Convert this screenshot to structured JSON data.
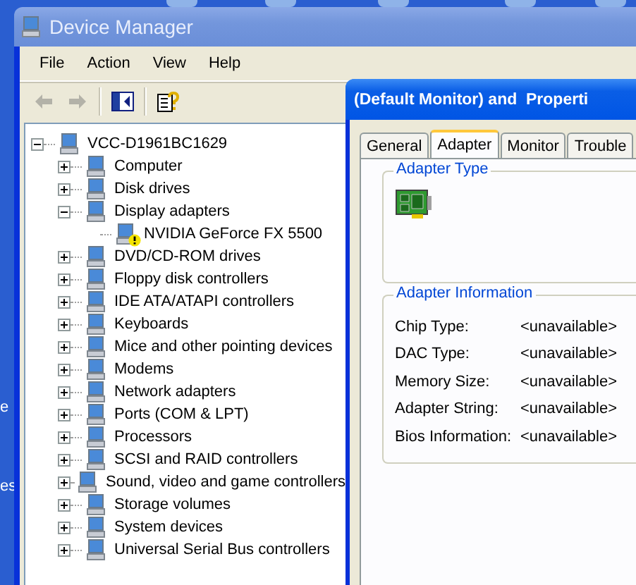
{
  "desktop": {
    "labels": [
      "e",
      "es"
    ]
  },
  "window": {
    "title": "Device Manager"
  },
  "menu": [
    "File",
    "Action",
    "View",
    "Help"
  ],
  "toolbar": [
    {
      "kind": "back",
      "disabled": true
    },
    {
      "kind": "forward",
      "disabled": true
    },
    {
      "kind": "separator"
    },
    {
      "kind": "console",
      "disabled": false
    },
    {
      "kind": "separator"
    },
    {
      "kind": "help",
      "disabled": false
    }
  ],
  "tree": {
    "label": "VCC-D1961BC1629",
    "expanded": true,
    "children": [
      {
        "label": "Computer",
        "expanded": false
      },
      {
        "label": "Disk drives",
        "expanded": false
      },
      {
        "label": "Display adapters",
        "expanded": true,
        "children": [
          {
            "label": "NVIDIA GeForce FX 5500",
            "warning": true
          }
        ]
      },
      {
        "label": "DVD/CD-ROM drives",
        "expanded": false
      },
      {
        "label": "Floppy disk controllers",
        "expanded": false
      },
      {
        "label": "IDE ATA/ATAPI controllers",
        "expanded": false
      },
      {
        "label": "Keyboards",
        "expanded": false
      },
      {
        "label": "Mice and other pointing devices",
        "expanded": false
      },
      {
        "label": "Modems",
        "expanded": false
      },
      {
        "label": "Network adapters",
        "expanded": false
      },
      {
        "label": "Ports (COM & LPT)",
        "expanded": false
      },
      {
        "label": "Processors",
        "expanded": false
      },
      {
        "label": "SCSI and RAID controllers",
        "expanded": false
      },
      {
        "label": "Sound, video and game controllers",
        "expanded": false
      },
      {
        "label": "Storage volumes",
        "expanded": false
      },
      {
        "label": "System devices",
        "expanded": false
      },
      {
        "label": "Universal Serial Bus controllers",
        "expanded": false
      }
    ]
  },
  "dialog": {
    "title": "(Default Monitor) and  Properti",
    "tabs": [
      {
        "label": "General",
        "selected": false
      },
      {
        "label": "Adapter",
        "selected": true
      },
      {
        "label": "Monitor",
        "selected": false
      },
      {
        "label": "Trouble",
        "selected": false
      }
    ],
    "adapter_type": {
      "heading": "Adapter Type"
    },
    "adapter_information": {
      "heading": "Adapter Information",
      "rows": [
        {
          "label": "Chip Type:",
          "value": "<unavailable>"
        },
        {
          "label": "DAC Type:",
          "value": "<unavailable>"
        },
        {
          "label": "Memory Size:",
          "value": "<unavailable>"
        },
        {
          "label": "Adapter String:",
          "value": "<unavailable>"
        },
        {
          "label": "Bios Information:",
          "value": "<unavailable>"
        }
      ]
    }
  }
}
